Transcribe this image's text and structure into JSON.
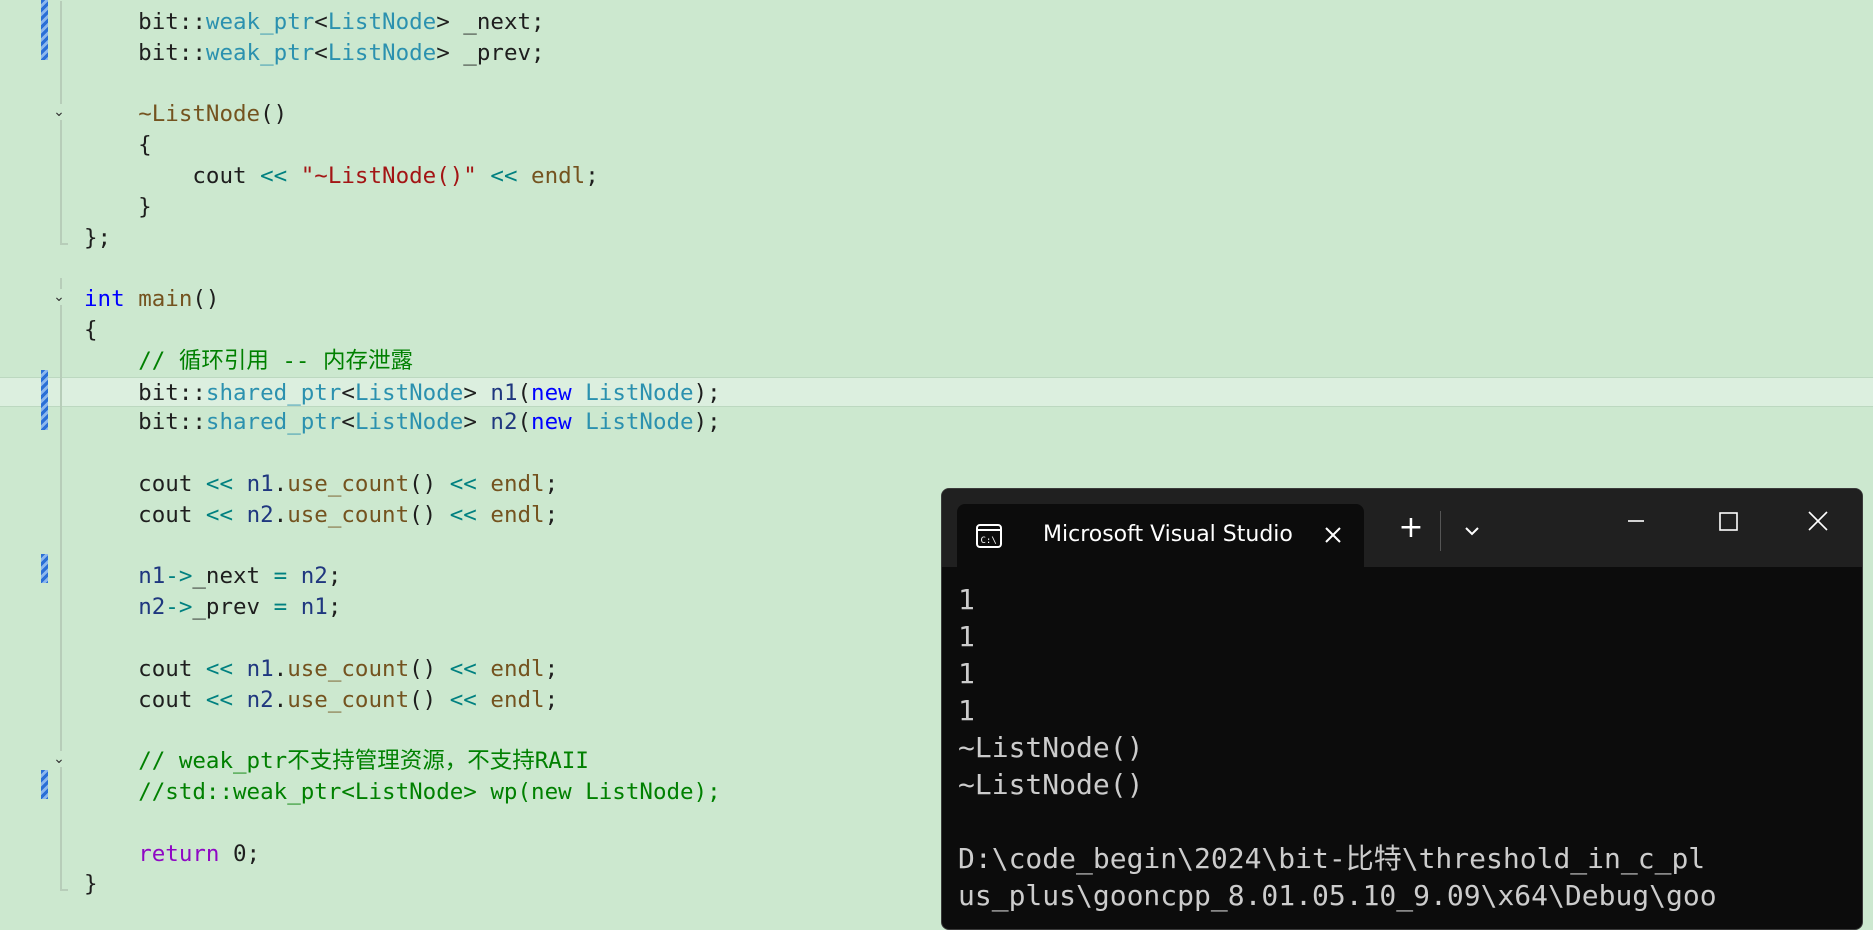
{
  "editor": {
    "lines": [
      {
        "segs": [
          {
            "t": "    bit::"
          },
          {
            "t": "weak_ptr",
            "c": "ty"
          },
          {
            "t": "<"
          },
          {
            "t": "ListNode",
            "c": "ty"
          },
          {
            "t": "> _next;"
          }
        ]
      },
      {
        "segs": [
          {
            "t": "    bit::"
          },
          {
            "t": "weak_ptr",
            "c": "ty"
          },
          {
            "t": "<"
          },
          {
            "t": "ListNode",
            "c": "ty"
          },
          {
            "t": "> _prev;"
          }
        ]
      },
      {
        "segs": []
      },
      {
        "segs": [
          {
            "t": "    "
          },
          {
            "t": "~ListNode",
            "c": "fn"
          },
          {
            "t": "()"
          }
        ]
      },
      {
        "segs": [
          {
            "t": "    {"
          }
        ]
      },
      {
        "segs": [
          {
            "t": "        cout "
          },
          {
            "t": "<<",
            "c": "op"
          },
          {
            "t": " "
          },
          {
            "t": "\"~ListNode()\"",
            "c": "str"
          },
          {
            "t": " "
          },
          {
            "t": "<<",
            "c": "op"
          },
          {
            "t": " "
          },
          {
            "t": "endl",
            "c": "fn"
          },
          {
            "t": ";"
          }
        ]
      },
      {
        "segs": [
          {
            "t": "    }"
          }
        ]
      },
      {
        "segs": [
          {
            "t": "};"
          }
        ]
      },
      {
        "segs": []
      },
      {
        "segs": [
          {
            "t": "int",
            "c": "k"
          },
          {
            "t": " "
          },
          {
            "t": "main",
            "c": "fn"
          },
          {
            "t": "()"
          }
        ]
      },
      {
        "segs": [
          {
            "t": "{"
          }
        ]
      },
      {
        "segs": [
          {
            "t": "    "
          },
          {
            "t": "// 循环引用 -- 内存泄露",
            "c": "cm"
          }
        ]
      },
      {
        "segs": [
          {
            "t": "    bit::"
          },
          {
            "t": "shared_ptr",
            "c": "ty"
          },
          {
            "t": "<"
          },
          {
            "t": "ListNode",
            "c": "ty"
          },
          {
            "t": "> "
          },
          {
            "t": "n1",
            "c": "var"
          },
          {
            "t": "("
          },
          {
            "t": "new",
            "c": "k"
          },
          {
            "t": " "
          },
          {
            "t": "ListNode",
            "c": "ty"
          },
          {
            "t": ");"
          }
        ]
      },
      {
        "segs": [
          {
            "t": "    bit::"
          },
          {
            "t": "shared_ptr",
            "c": "ty"
          },
          {
            "t": "<"
          },
          {
            "t": "ListNode",
            "c": "ty"
          },
          {
            "t": "> "
          },
          {
            "t": "n2",
            "c": "var"
          },
          {
            "t": "("
          },
          {
            "t": "new",
            "c": "k"
          },
          {
            "t": " "
          },
          {
            "t": "ListNode",
            "c": "ty"
          },
          {
            "t": ");"
          }
        ]
      },
      {
        "segs": []
      },
      {
        "segs": [
          {
            "t": "    cout "
          },
          {
            "t": "<<",
            "c": "op"
          },
          {
            "t": " "
          },
          {
            "t": "n1",
            "c": "var"
          },
          {
            "t": "."
          },
          {
            "t": "use_count",
            "c": "fn"
          },
          {
            "t": "() "
          },
          {
            "t": "<<",
            "c": "op"
          },
          {
            "t": " "
          },
          {
            "t": "endl",
            "c": "fn"
          },
          {
            "t": ";"
          }
        ]
      },
      {
        "segs": [
          {
            "t": "    cout "
          },
          {
            "t": "<<",
            "c": "op"
          },
          {
            "t": " "
          },
          {
            "t": "n2",
            "c": "var"
          },
          {
            "t": "."
          },
          {
            "t": "use_count",
            "c": "fn"
          },
          {
            "t": "() "
          },
          {
            "t": "<<",
            "c": "op"
          },
          {
            "t": " "
          },
          {
            "t": "endl",
            "c": "fn"
          },
          {
            "t": ";"
          }
        ]
      },
      {
        "segs": []
      },
      {
        "segs": [
          {
            "t": "    "
          },
          {
            "t": "n1",
            "c": "var"
          },
          {
            "t": "->",
            "c": "op"
          },
          {
            "t": "_next "
          },
          {
            "t": "=",
            "c": "op"
          },
          {
            "t": " "
          },
          {
            "t": "n2",
            "c": "var"
          },
          {
            "t": ";"
          }
        ]
      },
      {
        "segs": [
          {
            "t": "    "
          },
          {
            "t": "n2",
            "c": "var"
          },
          {
            "t": "->",
            "c": "op"
          },
          {
            "t": "_prev "
          },
          {
            "t": "=",
            "c": "op"
          },
          {
            "t": " "
          },
          {
            "t": "n1",
            "c": "var"
          },
          {
            "t": ";"
          }
        ]
      },
      {
        "segs": []
      },
      {
        "segs": [
          {
            "t": "    cout "
          },
          {
            "t": "<<",
            "c": "op"
          },
          {
            "t": " "
          },
          {
            "t": "n1",
            "c": "var"
          },
          {
            "t": "."
          },
          {
            "t": "use_count",
            "c": "fn"
          },
          {
            "t": "() "
          },
          {
            "t": "<<",
            "c": "op"
          },
          {
            "t": " "
          },
          {
            "t": "endl",
            "c": "fn"
          },
          {
            "t": ";"
          }
        ]
      },
      {
        "segs": [
          {
            "t": "    cout "
          },
          {
            "t": "<<",
            "c": "op"
          },
          {
            "t": " "
          },
          {
            "t": "n2",
            "c": "var"
          },
          {
            "t": "."
          },
          {
            "t": "use_count",
            "c": "fn"
          },
          {
            "t": "() "
          },
          {
            "t": "<<",
            "c": "op"
          },
          {
            "t": " "
          },
          {
            "t": "endl",
            "c": "fn"
          },
          {
            "t": ";"
          }
        ]
      },
      {
        "segs": []
      },
      {
        "segs": [
          {
            "t": "    "
          },
          {
            "t": "// weak_ptr不支持管理资源，不支持RAII",
            "c": "cm"
          }
        ]
      },
      {
        "segs": [
          {
            "t": "    "
          },
          {
            "t": "//std::weak_ptr<ListNode> wp(new ListNode);",
            "c": "cm"
          }
        ]
      },
      {
        "segs": []
      },
      {
        "segs": [
          {
            "t": "    "
          },
          {
            "t": "return",
            "c": "ret"
          },
          {
            "t": " 0;"
          }
        ]
      },
      {
        "segs": [
          {
            "t": "}"
          }
        ]
      }
    ],
    "current_line_index": 12,
    "collapse_glyph": "⌄"
  },
  "terminal": {
    "tab_title": "Microsoft Visual Studio",
    "tab_icon": "console-icon",
    "new_tab_glyph": "+",
    "dropdown_icon": "chevron-down-icon",
    "output": "1\n1\n1\n1\n~ListNode()\n~ListNode()\n\nD:\\code_begin\\2024\\bit-比特\\threshold_in_c_pl\nus_plus\\gooncpp_8.01.05.10_9.09\\x64\\Debug\\goo"
  }
}
